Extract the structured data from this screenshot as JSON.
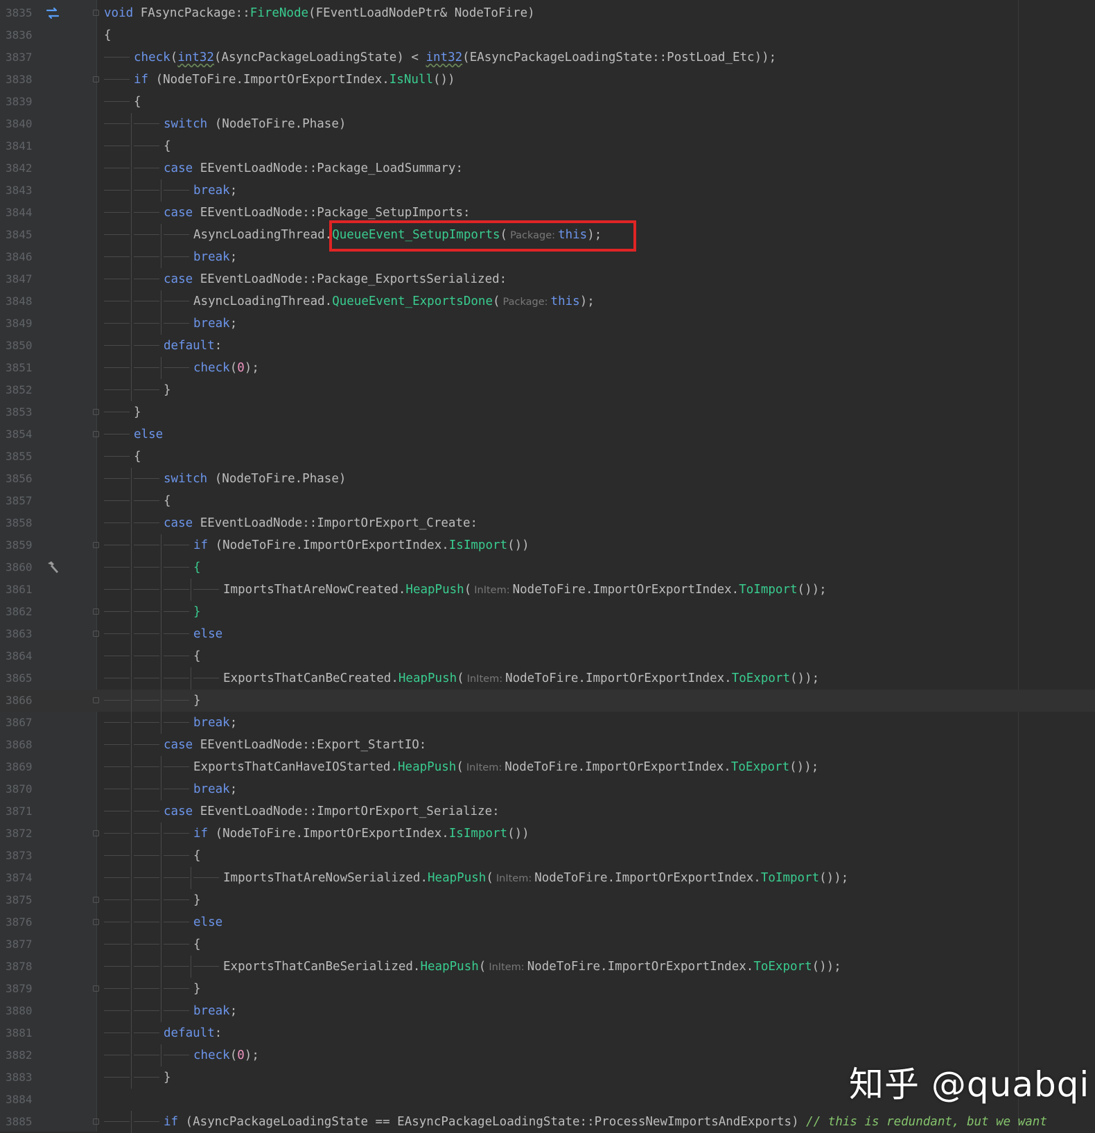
{
  "editor": {
    "lines": [
      {
        "num": "3835",
        "indent": 0,
        "tokens": [
          [
            "kw",
            "void"
          ],
          [
            "p",
            " FAsyncPackage::"
          ],
          [
            "fn",
            "FireNode"
          ],
          [
            "p",
            "(FEventLoadNodePtr& NodeToFire)"
          ]
        ]
      },
      {
        "num": "3836",
        "indent": 0,
        "tokens": [
          [
            "p",
            "{"
          ]
        ]
      },
      {
        "num": "3837",
        "indent": 1,
        "tokens": [
          [
            "kw",
            "check"
          ],
          [
            "p",
            "("
          ],
          [
            "ty",
            "int32"
          ],
          [
            "p",
            "(AsyncPackageLoadingState) < "
          ],
          [
            "ty",
            "int32"
          ],
          [
            "p",
            "(EAsyncPackageLoadingState::PostLoad_Etc));"
          ]
        ]
      },
      {
        "num": "3838",
        "indent": 1,
        "tokens": [
          [
            "kw",
            "if"
          ],
          [
            "p",
            " (NodeToFire.ImportOrExportIndex."
          ],
          [
            "fn",
            "IsNull"
          ],
          [
            "p",
            "())"
          ]
        ]
      },
      {
        "num": "3839",
        "indent": 1,
        "tokens": [
          [
            "p",
            "{"
          ]
        ]
      },
      {
        "num": "3840",
        "indent": 2,
        "tokens": [
          [
            "kw",
            "switch"
          ],
          [
            "p",
            " (NodeToFire.Phase)"
          ]
        ]
      },
      {
        "num": "3841",
        "indent": 2,
        "tokens": [
          [
            "p",
            "{"
          ]
        ]
      },
      {
        "num": "3842",
        "indent": 2,
        "tokens": [
          [
            "kw",
            "case"
          ],
          [
            "p",
            " EEventLoadNode::Package_LoadSummary:"
          ]
        ]
      },
      {
        "num": "3843",
        "indent": 3,
        "tokens": [
          [
            "kw",
            "break"
          ],
          [
            "p",
            ";"
          ]
        ]
      },
      {
        "num": "3844",
        "indent": 2,
        "tokens": [
          [
            "kw",
            "case"
          ],
          [
            "p",
            " EEventLoadNode::Package_SetupImports:"
          ]
        ]
      },
      {
        "num": "3845",
        "indent": 3,
        "tokens": [
          [
            "p",
            "AsyncLoadingThread."
          ],
          [
            "fn",
            "QueueEvent_SetupImports"
          ],
          [
            "p",
            "("
          ],
          [
            "hint",
            "Package:"
          ],
          [
            "kw",
            "this"
          ],
          [
            "p",
            ");"
          ]
        ]
      },
      {
        "num": "3846",
        "indent": 3,
        "tokens": [
          [
            "kw",
            "break"
          ],
          [
            "p",
            ";"
          ]
        ]
      },
      {
        "num": "3847",
        "indent": 2,
        "tokens": [
          [
            "kw",
            "case"
          ],
          [
            "p",
            " EEventLoadNode::Package_ExportsSerialized:"
          ]
        ]
      },
      {
        "num": "3848",
        "indent": 3,
        "tokens": [
          [
            "p",
            "AsyncLoadingThread."
          ],
          [
            "fn",
            "QueueEvent_ExportsDone"
          ],
          [
            "p",
            "("
          ],
          [
            "hint",
            "Package:"
          ],
          [
            "kw",
            "this"
          ],
          [
            "p",
            ");"
          ]
        ]
      },
      {
        "num": "3849",
        "indent": 3,
        "tokens": [
          [
            "kw",
            "break"
          ],
          [
            "p",
            ";"
          ]
        ]
      },
      {
        "num": "3850",
        "indent": 2,
        "tokens": [
          [
            "kw",
            "default"
          ],
          [
            "p",
            ":"
          ]
        ]
      },
      {
        "num": "3851",
        "indent": 3,
        "tokens": [
          [
            "kw",
            "check"
          ],
          [
            "p",
            "("
          ],
          [
            "num",
            "0"
          ],
          [
            "p",
            ");"
          ]
        ]
      },
      {
        "num": "3852",
        "indent": 2,
        "tokens": [
          [
            "p",
            "}"
          ]
        ]
      },
      {
        "num": "3853",
        "indent": 1,
        "tokens": [
          [
            "p",
            "}"
          ]
        ]
      },
      {
        "num": "3854",
        "indent": 1,
        "tokens": [
          [
            "kw",
            "else"
          ]
        ]
      },
      {
        "num": "3855",
        "indent": 1,
        "tokens": [
          [
            "p",
            "{"
          ]
        ]
      },
      {
        "num": "3856",
        "indent": 2,
        "tokens": [
          [
            "kw",
            "switch"
          ],
          [
            "p",
            " (NodeToFire.Phase)"
          ]
        ]
      },
      {
        "num": "3857",
        "indent": 2,
        "tokens": [
          [
            "p",
            "{"
          ]
        ]
      },
      {
        "num": "3858",
        "indent": 2,
        "tokens": [
          [
            "kw",
            "case"
          ],
          [
            "p",
            " EEventLoadNode::ImportOrExport_Create:"
          ]
        ]
      },
      {
        "num": "3859",
        "indent": 3,
        "tokens": [
          [
            "kw",
            "if"
          ],
          [
            "p",
            " (NodeToFire.ImportOrExportIndex."
          ],
          [
            "fn",
            "IsImport"
          ],
          [
            "p",
            "())"
          ]
        ]
      },
      {
        "num": "3860",
        "indent": 3,
        "tokens": [
          [
            "fn",
            "{"
          ]
        ]
      },
      {
        "num": "3861",
        "indent": 4,
        "tokens": [
          [
            "p",
            "ImportsThatAreNowCreated."
          ],
          [
            "fn",
            "HeapPush"
          ],
          [
            "p",
            "("
          ],
          [
            "hint",
            "InItem:"
          ],
          [
            "p",
            "NodeToFire.ImportOrExportIndex."
          ],
          [
            "fn",
            "ToImport"
          ],
          [
            "p",
            "());"
          ]
        ]
      },
      {
        "num": "3862",
        "indent": 3,
        "tokens": [
          [
            "fn",
            "}"
          ]
        ]
      },
      {
        "num": "3863",
        "indent": 3,
        "tokens": [
          [
            "kw",
            "else"
          ]
        ]
      },
      {
        "num": "3864",
        "indent": 3,
        "tokens": [
          [
            "p",
            "{"
          ]
        ]
      },
      {
        "num": "3865",
        "indent": 4,
        "tokens": [
          [
            "p",
            "ExportsThatCanBeCreated."
          ],
          [
            "fn",
            "HeapPush"
          ],
          [
            "p",
            "("
          ],
          [
            "hint",
            "InItem:"
          ],
          [
            "p",
            "NodeToFire.ImportOrExportIndex."
          ],
          [
            "fn",
            "ToExport"
          ],
          [
            "p",
            "());"
          ]
        ]
      },
      {
        "num": "3866",
        "indent": 3,
        "tokens": [
          [
            "p",
            "}"
          ]
        ]
      },
      {
        "num": "3867",
        "indent": 3,
        "tokens": [
          [
            "kw",
            "break"
          ],
          [
            "p",
            ";"
          ]
        ]
      },
      {
        "num": "3868",
        "indent": 2,
        "tokens": [
          [
            "kw",
            "case"
          ],
          [
            "p",
            " EEventLoadNode::Export_StartIO:"
          ]
        ]
      },
      {
        "num": "3869",
        "indent": 3,
        "tokens": [
          [
            "p",
            "ExportsThatCanHaveIOStarted."
          ],
          [
            "fn",
            "HeapPush"
          ],
          [
            "p",
            "("
          ],
          [
            "hint",
            "InItem:"
          ],
          [
            "p",
            "NodeToFire.ImportOrExportIndex."
          ],
          [
            "fn",
            "ToExport"
          ],
          [
            "p",
            "());"
          ]
        ]
      },
      {
        "num": "3870",
        "indent": 3,
        "tokens": [
          [
            "kw",
            "break"
          ],
          [
            "p",
            ";"
          ]
        ]
      },
      {
        "num": "3871",
        "indent": 2,
        "tokens": [
          [
            "kw",
            "case"
          ],
          [
            "p",
            " EEventLoadNode::ImportOrExport_Serialize:"
          ]
        ]
      },
      {
        "num": "3872",
        "indent": 3,
        "tokens": [
          [
            "kw",
            "if"
          ],
          [
            "p",
            " (NodeToFire.ImportOrExportIndex."
          ],
          [
            "fn",
            "IsImport"
          ],
          [
            "p",
            "())"
          ]
        ]
      },
      {
        "num": "3873",
        "indent": 3,
        "tokens": [
          [
            "p",
            "{"
          ]
        ]
      },
      {
        "num": "3874",
        "indent": 4,
        "tokens": [
          [
            "p",
            "ImportsThatAreNowSerialized."
          ],
          [
            "fn",
            "HeapPush"
          ],
          [
            "p",
            "("
          ],
          [
            "hint",
            "InItem:"
          ],
          [
            "p",
            "NodeToFire.ImportOrExportIndex."
          ],
          [
            "fn",
            "ToImport"
          ],
          [
            "p",
            "());"
          ]
        ]
      },
      {
        "num": "3875",
        "indent": 3,
        "tokens": [
          [
            "p",
            "}"
          ]
        ]
      },
      {
        "num": "3876",
        "indent": 3,
        "tokens": [
          [
            "kw",
            "else"
          ]
        ]
      },
      {
        "num": "3877",
        "indent": 3,
        "tokens": [
          [
            "p",
            "{"
          ]
        ]
      },
      {
        "num": "3878",
        "indent": 4,
        "tokens": [
          [
            "p",
            "ExportsThatCanBeSerialized."
          ],
          [
            "fn",
            "HeapPush"
          ],
          [
            "p",
            "("
          ],
          [
            "hint",
            "InItem:"
          ],
          [
            "p",
            "NodeToFire.ImportOrExportIndex."
          ],
          [
            "fn",
            "ToExport"
          ],
          [
            "p",
            "());"
          ]
        ]
      },
      {
        "num": "3879",
        "indent": 3,
        "tokens": [
          [
            "p",
            "}"
          ]
        ]
      },
      {
        "num": "3880",
        "indent": 3,
        "tokens": [
          [
            "kw",
            "break"
          ],
          [
            "p",
            ";"
          ]
        ]
      },
      {
        "num": "3881",
        "indent": 2,
        "tokens": [
          [
            "kw",
            "default"
          ],
          [
            "p",
            ":"
          ]
        ]
      },
      {
        "num": "3882",
        "indent": 3,
        "tokens": [
          [
            "kw",
            "check"
          ],
          [
            "p",
            "("
          ],
          [
            "num",
            "0"
          ],
          [
            "p",
            ");"
          ]
        ]
      },
      {
        "num": "3883",
        "indent": 2,
        "tokens": [
          [
            "p",
            "}"
          ]
        ]
      },
      {
        "num": "3884",
        "indent": -1,
        "tokens": []
      },
      {
        "num": "3885",
        "indent": 2,
        "tokens": [
          [
            "kw",
            "if"
          ],
          [
            "p",
            " (AsyncPackageLoadingState == EAsyncPackageLoadingState::ProcessNewImportsAndExports) "
          ],
          [
            "cmt",
            "// this is redundant, but we want"
          ]
        ]
      }
    ],
    "current_line": "3866",
    "gutter_icons": {
      "3835": "override-arrows-icon",
      "3860": "hammer-icon"
    },
    "fold_lines": [
      "3835",
      "3838",
      "3853",
      "3854",
      "3859",
      "3862",
      "3863",
      "3866",
      "3872",
      "3875",
      "3876",
      "3879",
      "3885"
    ],
    "highlight_line": "3845"
  },
  "watermark": {
    "text": "知乎 @quabqi"
  },
  "colors": {
    "background": "#2b2b2b",
    "keyword": "#6c95eb",
    "function": "#39cc8f",
    "text": "#bdbdbd",
    "number": "#ed94c0",
    "comment": "#85c46c",
    "highlight_border": "#e02424"
  }
}
